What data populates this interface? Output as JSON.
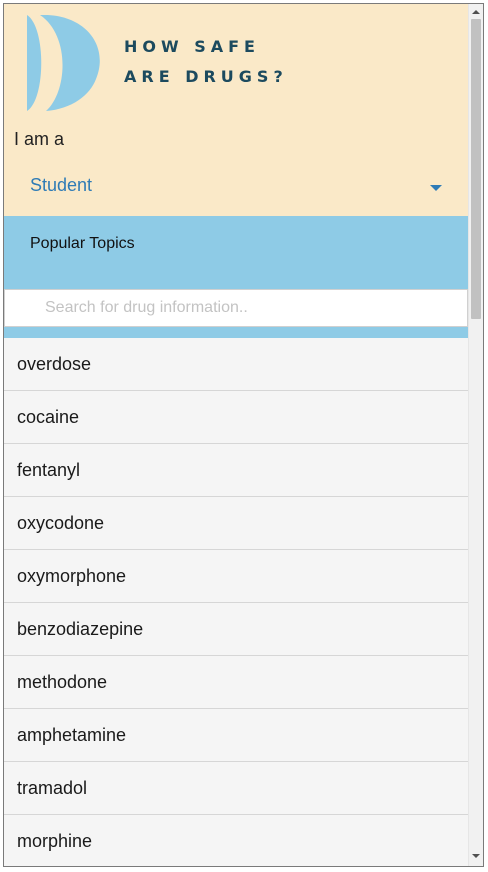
{
  "header": {
    "logo_icon": "crescent-brackets-logo-icon",
    "logo_color": "#8ecbe6",
    "title_line1": "HOW SAFE",
    "title_line2": "ARE DRUGS?",
    "role_prompt": "I am a",
    "role_selected": "Student",
    "background": "#fae9c8"
  },
  "topics": {
    "label": "Popular Topics",
    "background": "#8ecbe6"
  },
  "search": {
    "placeholder": "Search for drug information..",
    "value": ""
  },
  "drug_list": [
    "overdose",
    "cocaine",
    "fentanyl",
    "oxycodone",
    "oxymorphone",
    "benzodiazepine",
    "methodone",
    "amphetamine",
    "tramadol",
    "morphine"
  ],
  "colors": {
    "title": "#1c4a5e",
    "accent": "#2e7bb6",
    "list_background": "#f5f5f5"
  }
}
